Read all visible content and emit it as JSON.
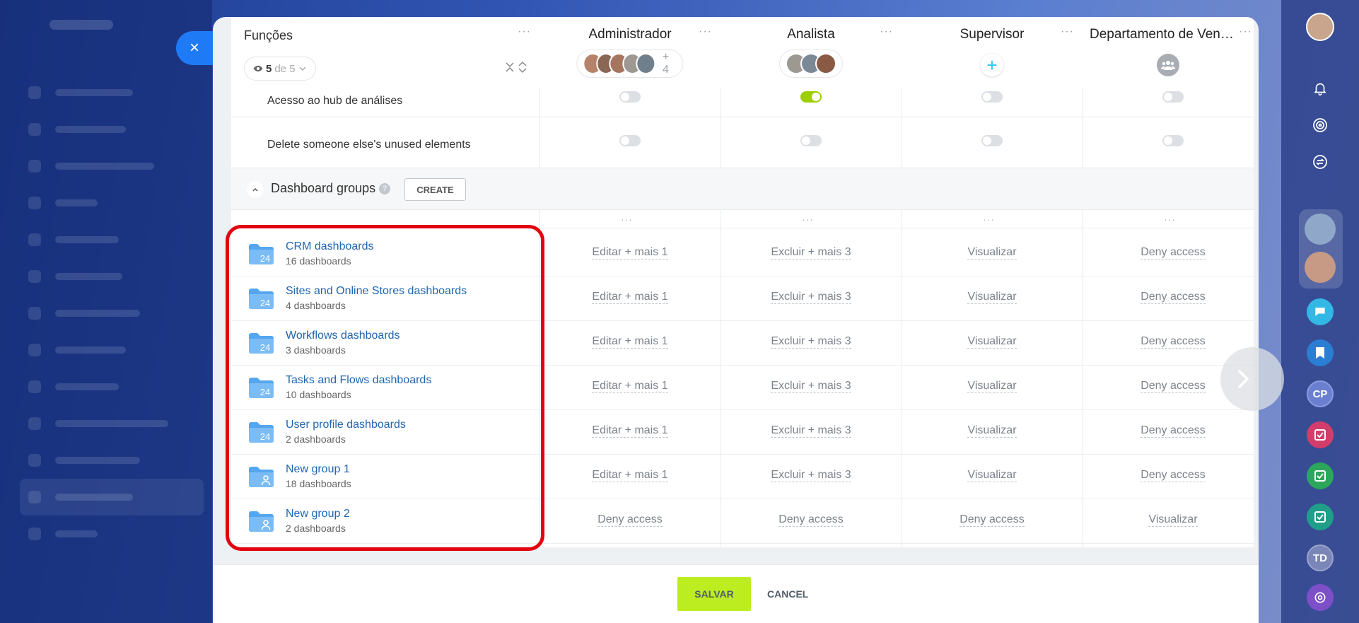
{
  "window": {
    "close_label": "×"
  },
  "header": {
    "functions_label": "Funções",
    "view_count": "5",
    "view_of": "de 5",
    "roles": [
      {
        "name": "Administrador",
        "more": "+ 4"
      },
      {
        "name": "Analista"
      },
      {
        "name": "Supervisor",
        "add_label": "+"
      },
      {
        "name": "Departamento de Vendas"
      }
    ],
    "dots": "···"
  },
  "permissions": [
    {
      "label": "Acesso ao hub de análises",
      "values": [
        false,
        true,
        false,
        false
      ]
    },
    {
      "label": "Delete someone else's unused elements",
      "values": [
        false,
        false,
        false,
        false
      ]
    }
  ],
  "section": {
    "title": "Dashboard groups",
    "help": "?",
    "create_label": "CREATE"
  },
  "groups": [
    {
      "name": "CRM dashboards",
      "count": "16 dashboards",
      "icon": "folder-24-icon",
      "cells": [
        "Editar + mais 1",
        "Excluir + mais 3",
        "Visualizar",
        "Deny access"
      ]
    },
    {
      "name": "Sites and Online Stores dashboards",
      "count": "4 dashboards",
      "icon": "folder-24-icon",
      "cells": [
        "Editar + mais 1",
        "Excluir + mais 3",
        "Visualizar",
        "Deny access"
      ]
    },
    {
      "name": "Workflows dashboards",
      "count": "3 dashboards",
      "icon": "folder-24-icon",
      "cells": [
        "Editar + mais 1",
        "Excluir + mais 3",
        "Visualizar",
        "Deny access"
      ]
    },
    {
      "name": "Tasks and Flows dashboards",
      "count": "10 dashboards",
      "icon": "folder-24-icon",
      "cells": [
        "Editar + mais 1",
        "Excluir + mais 3",
        "Visualizar",
        "Deny access"
      ]
    },
    {
      "name": "User profile dashboards",
      "count": "2 dashboards",
      "icon": "folder-24-icon",
      "cells": [
        "Editar + mais 1",
        "Excluir + mais 3",
        "Visualizar",
        "Deny access"
      ]
    },
    {
      "name": "New group 1",
      "count": "18 dashboards",
      "icon": "folder-user-icon",
      "cells": [
        "Editar + mais 1",
        "Excluir + mais 3",
        "Visualizar",
        "Deny access"
      ]
    },
    {
      "name": "New group 2",
      "count": "2 dashboards",
      "icon": "folder-user-icon",
      "cells": [
        "Deny access",
        "Deny access",
        "Deny access",
        "Visualizar"
      ]
    }
  ],
  "footer": {
    "save_label": "SALVAR",
    "cancel_label": "CANCEL"
  },
  "rail": {
    "cp_label": "CP",
    "td_label": "TD"
  },
  "colors": {
    "accent_blue": "#1f7bf5",
    "link_blue": "#2066b0",
    "save_green": "#bbed21",
    "toggle_on": "#9dcf00",
    "highlight_red": "#e3000f",
    "add_cyan": "#2fc6f6"
  }
}
